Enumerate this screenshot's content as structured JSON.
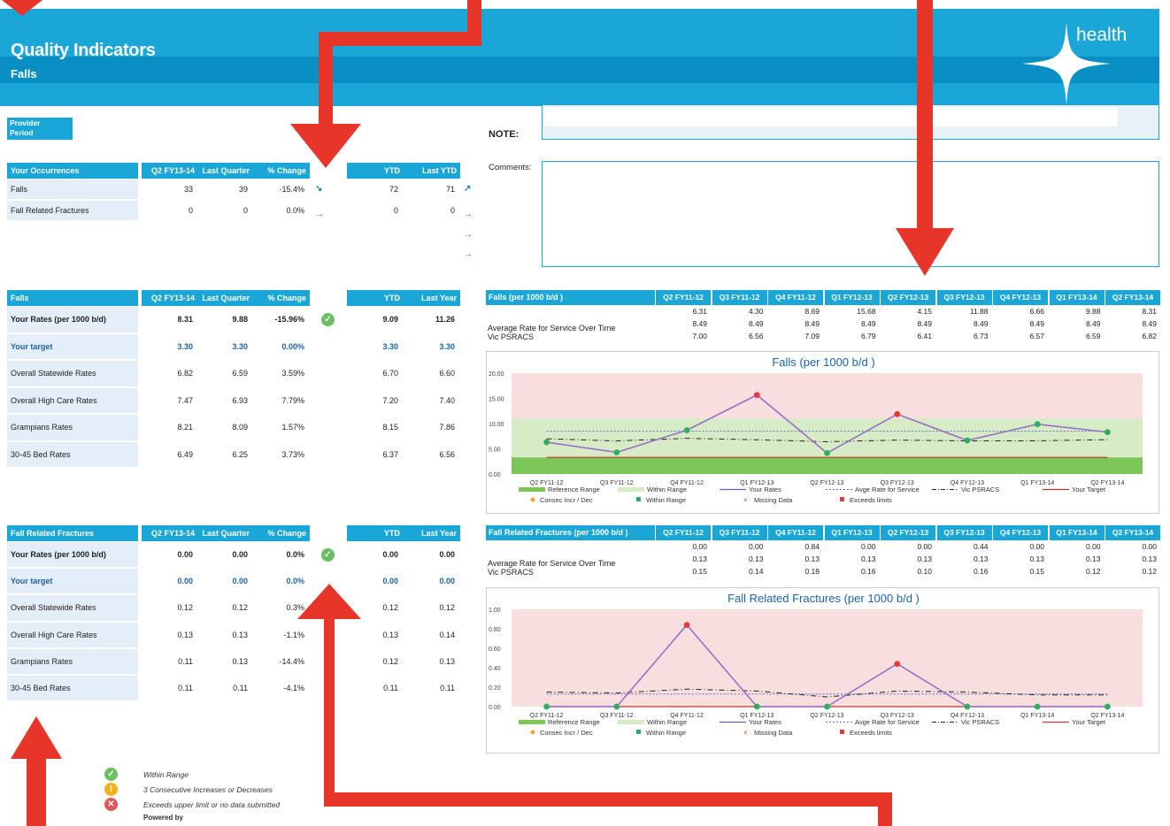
{
  "header": {
    "title": "Quality Indicators",
    "subtitle": "Falls",
    "brand": "health"
  },
  "provider": {
    "line1": "Provider",
    "line2": "Period"
  },
  "note": {
    "label": "NOTE:",
    "comments_label": "Comments:"
  },
  "occurrences": {
    "headers": [
      "Your Occurrences",
      "Q2 FY13-14",
      "Last Quarter",
      "% Change",
      "YTD",
      "Last YTD"
    ],
    "rows": [
      {
        "label": "Falls",
        "q": "33",
        "lq": "39",
        "pct": "-15.4%",
        "ytd": "72",
        "lytd": "71"
      },
      {
        "label": "Fall Related Fractures",
        "q": "0",
        "lq": "0",
        "pct": "0.0%",
        "ytd": "0",
        "lytd": "0"
      }
    ]
  },
  "falls_table": {
    "headers": [
      "Falls",
      "Q2 FY13-14",
      "Last Quarter",
      "% Change",
      "YTD",
      "Last Year"
    ],
    "rows": [
      {
        "label": "Your Rates (per 1000 b/d)",
        "q": "8.31",
        "lq": "9.88",
        "pct": "-15.96%",
        "ytd": "9.09",
        "ly": "11.26",
        "bold": true
      },
      {
        "label": "Your target",
        "q": "3.30",
        "lq": "3.30",
        "pct": "0.00%",
        "ytd": "3.30",
        "ly": "3.30",
        "target": true
      },
      {
        "label": "Overall Statewide Rates",
        "q": "6.82",
        "lq": "6.59",
        "pct": "3.59%",
        "ytd": "6.70",
        "ly": "6.60"
      },
      {
        "label": "Overall High Care Rates",
        "q": "7.47",
        "lq": "6.93",
        "pct": "7.79%",
        "ytd": "7.20",
        "ly": "7.40"
      },
      {
        "label": "Grampians Rates",
        "q": "8.21",
        "lq": "8.09",
        "pct": "1.57%",
        "ytd": "8.15",
        "ly": "7.86"
      },
      {
        "label": "30-45 Bed Rates",
        "q": "6.49",
        "lq": "6.25",
        "pct": "3.73%",
        "ytd": "6.37",
        "ly": "6.56"
      }
    ]
  },
  "fractures_table": {
    "headers": [
      "Fall Related Fractures",
      "Q2 FY13-14",
      "Last Quarter",
      "% Change",
      "YTD",
      "Last Year"
    ],
    "rows": [
      {
        "label": "Your Rates (per 1000 b/d)",
        "q": "0.00",
        "lq": "0.00",
        "pct": "0.0%",
        "ytd": "0.00",
        "ly": "0.00",
        "bold": true
      },
      {
        "label": "Your target",
        "q": "0.00",
        "lq": "0.00",
        "pct": "0.0%",
        "ytd": "0.00",
        "ly": "0.00",
        "target": true
      },
      {
        "label": "Overall Statewide Rates",
        "q": "0.12",
        "lq": "0.12",
        "pct": "0.3%",
        "ytd": "0.12",
        "ly": "0.12"
      },
      {
        "label": "Overall High Care Rates",
        "q": "0.13",
        "lq": "0.13",
        "pct": "-1.1%",
        "ytd": "0.13",
        "ly": "0.14"
      },
      {
        "label": "Grampians Rates",
        "q": "0.11",
        "lq": "0.13",
        "pct": "-14.4%",
        "ytd": "0.12",
        "ly": "0.13"
      },
      {
        "label": "30-45 Bed Rates",
        "q": "0.11",
        "lq": "0.11",
        "pct": "-4.1%",
        "ytd": "0.11",
        "ly": "0.11"
      }
    ]
  },
  "legend_bottom": {
    "items": [
      "Within Range",
      "3 Consecutive Increases or Decreases",
      "Exceeds upper limit or no data submitted"
    ],
    "powered": "Powered by"
  },
  "chart_data": [
    {
      "type": "line",
      "title": "Falls (per 1000 b/d )",
      "table_header": "Falls (per 1000 b/d )",
      "categories": [
        "Q2 FY11-12",
        "Q3 FY11-12",
        "Q4 FY11-12",
        "Q1 FY12-13",
        "Q2 FY12-13",
        "Q3 FY12-13",
        "Q4 FY12-13",
        "Q1 FY13-14",
        "Q2 FY13-14"
      ],
      "table_rows": [
        {
          "label": "",
          "values": [
            "6.31",
            "4.30",
            "8.69",
            "15.68",
            "4.15",
            "11.88",
            "6.66",
            "9.88",
            "8.31"
          ]
        },
        {
          "label": "Average Rate for Service Over Time",
          "values": [
            "8.49",
            "8.49",
            "8.49",
            "8.49",
            "8.49",
            "8.49",
            "8.49",
            "8.49",
            "8.49"
          ]
        },
        {
          "label": "Vic PSRACS",
          "values": [
            "7.00",
            "6.56",
            "7.09",
            "6.79",
            "6.41",
            "6.73",
            "6.57",
            "6.59",
            "6.82"
          ]
        }
      ],
      "series": [
        {
          "name": "Your Rates",
          "values": [
            6.31,
            4.3,
            8.69,
            15.68,
            4.15,
            11.88,
            6.66,
            9.88,
            8.31
          ]
        },
        {
          "name": "Avge Rate for Service",
          "values": [
            8.49,
            8.49,
            8.49,
            8.49,
            8.49,
            8.49,
            8.49,
            8.49,
            8.49
          ]
        },
        {
          "name": "Vic PSRACS",
          "values": [
            7.0,
            6.56,
            7.09,
            6.79,
            6.41,
            6.73,
            6.57,
            6.59,
            6.82
          ]
        },
        {
          "name": "Your Target",
          "values": [
            3.3,
            3.3,
            3.3,
            3.3,
            3.3,
            3.3,
            3.3,
            3.3,
            3.3
          ]
        }
      ],
      "bands": {
        "reference": [
          0,
          3.3
        ],
        "within": [
          3.3,
          11.0
        ]
      },
      "exceeds": [
        3,
        5
      ],
      "ylim": [
        0,
        20
      ],
      "yticks": [
        "0.00",
        "5.00",
        "10.00",
        "15.00",
        "20.00"
      ],
      "legend": [
        "Reference Range",
        "Within Range",
        "Your Rates",
        "Avge Rate for Service",
        "Vic PSRACS",
        "Your Target",
        "Consec Incr / Dec",
        "Within Range",
        "Missing Data",
        "Exceeds limits"
      ]
    },
    {
      "type": "line",
      "title": "Fall Related Fractures (per 1000 b/d )",
      "table_header": "Fall Related Fractures (per 1000 b/d )",
      "categories": [
        "Q2 FY11-12",
        "Q3 FY11-12",
        "Q4 FY11-12",
        "Q1 FY12-13",
        "Q2 FY12-13",
        "Q3 FY12-13",
        "Q4 FY12-13",
        "Q1 FY13-14",
        "Q2 FY13-14"
      ],
      "table_rows": [
        {
          "label": "",
          "values": [
            "0.00",
            "0.00",
            "0.84",
            "0.00",
            "0.00",
            "0.44",
            "0.00",
            "0.00",
            "0.00"
          ]
        },
        {
          "label": "Average Rate for Service Over Time",
          "values": [
            "0.13",
            "0.13",
            "0.13",
            "0.13",
            "0.13",
            "0.13",
            "0.13",
            "0.13",
            "0.13"
          ]
        },
        {
          "label": "Vic PSRACS",
          "values": [
            "0.15",
            "0.14",
            "0.18",
            "0.16",
            "0.10",
            "0.16",
            "0.15",
            "0.12",
            "0.12"
          ]
        }
      ],
      "series": [
        {
          "name": "Your Rates",
          "values": [
            0,
            0,
            0.84,
            0,
            0,
            0.44,
            0,
            0,
            0
          ]
        },
        {
          "name": "Avge Rate for Service",
          "values": [
            0.13,
            0.13,
            0.13,
            0.13,
            0.13,
            0.13,
            0.13,
            0.13,
            0.13
          ]
        },
        {
          "name": "Vic PSRACS",
          "values": [
            0.15,
            0.14,
            0.18,
            0.16,
            0.1,
            0.16,
            0.15,
            0.12,
            0.12
          ]
        },
        {
          "name": "Your Target",
          "values": [
            0,
            0,
            0,
            0,
            0,
            0,
            0,
            0,
            0
          ]
        }
      ],
      "bands": {
        "reference": [
          0,
          0
        ],
        "within": [
          0,
          0
        ]
      },
      "exceeds": [
        2,
        5
      ],
      "ylim": [
        0,
        1
      ],
      "yticks": [
        "0.00",
        "0.20",
        "0.40",
        "0.60",
        "0.80",
        "1.00"
      ],
      "legend": [
        "Reference Range",
        "Within Range",
        "Your Rates",
        "Avge Rate for Service",
        "Vic PSRACS",
        "Your Target",
        "Consec Incr / Dec",
        "Within Range",
        "Missing Data",
        "Exceeds limits"
      ]
    }
  ],
  "colors": {
    "accent": "#1ba6d8",
    "dark": "#0a8fc4",
    "red_arrow": "#e8352a",
    "ok": "#6abf62",
    "pink": "#f8dede",
    "green_band": "#d7ecc6",
    "ref_band": "#7cc558",
    "series": "#9b6fc2"
  }
}
